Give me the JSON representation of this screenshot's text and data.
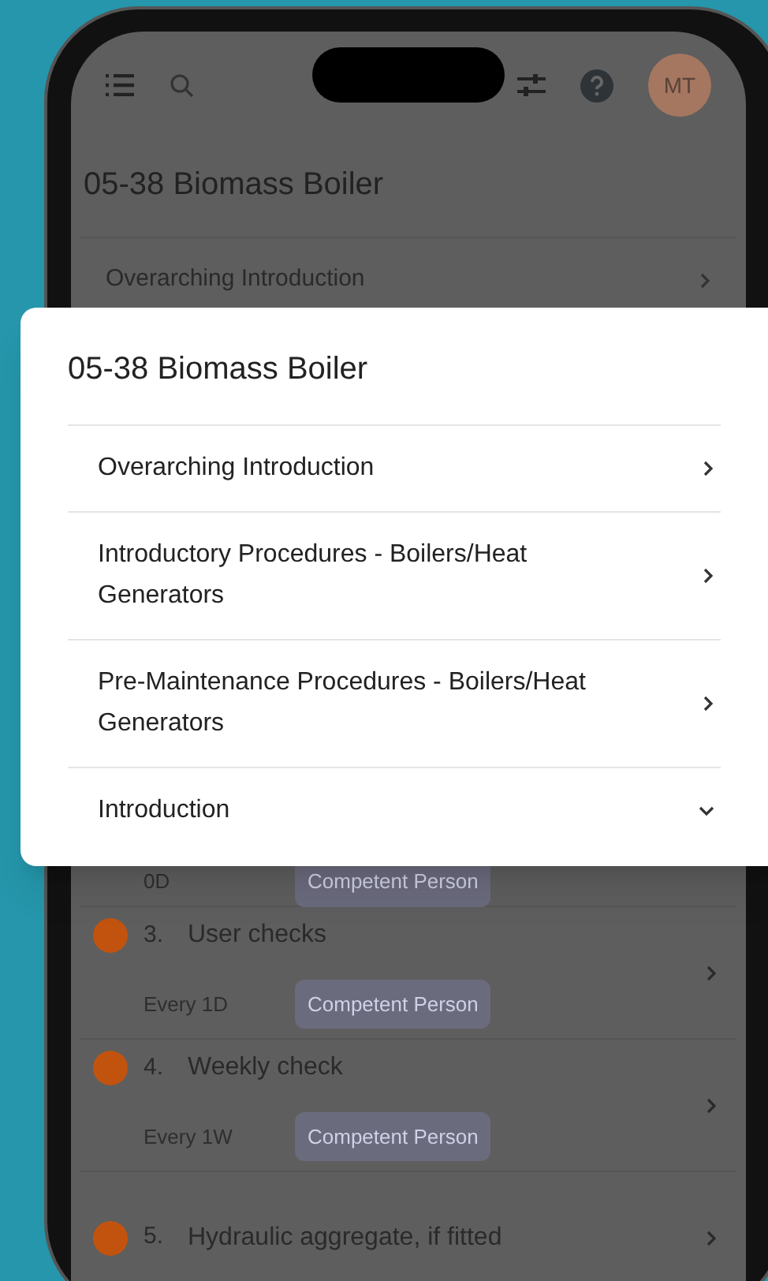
{
  "app_bar": {
    "avatar": "MT"
  },
  "page": {
    "title": "05-38 Biomass Boiler",
    "sections": [
      {
        "label": "Overarching Introduction"
      }
    ],
    "tasks": [
      {
        "frequency": "0D",
        "role": "Competent Person"
      },
      {
        "number": "3.",
        "title": "User checks",
        "frequency": "Every 1D",
        "role": "Competent Person",
        "color": "#c2530e"
      },
      {
        "number": "4.",
        "title": "Weekly check",
        "frequency": "Every 1W",
        "role": "Competent Person",
        "color": "#c2530e"
      },
      {
        "number": "5.",
        "title": "Hydraulic aggregate, if fitted",
        "color": "#c2530e"
      }
    ]
  },
  "popup": {
    "title": "05-38 Biomass Boiler",
    "items": [
      {
        "label": "Overarching Introduction",
        "expanded": false
      },
      {
        "label": "Introductory Procedures - Boilers/Heat Generators",
        "expanded": false
      },
      {
        "label": "Pre-Maintenance Procedures - Boilers/Heat Generators",
        "expanded": false
      },
      {
        "label": "Introduction",
        "expanded": true
      }
    ]
  }
}
